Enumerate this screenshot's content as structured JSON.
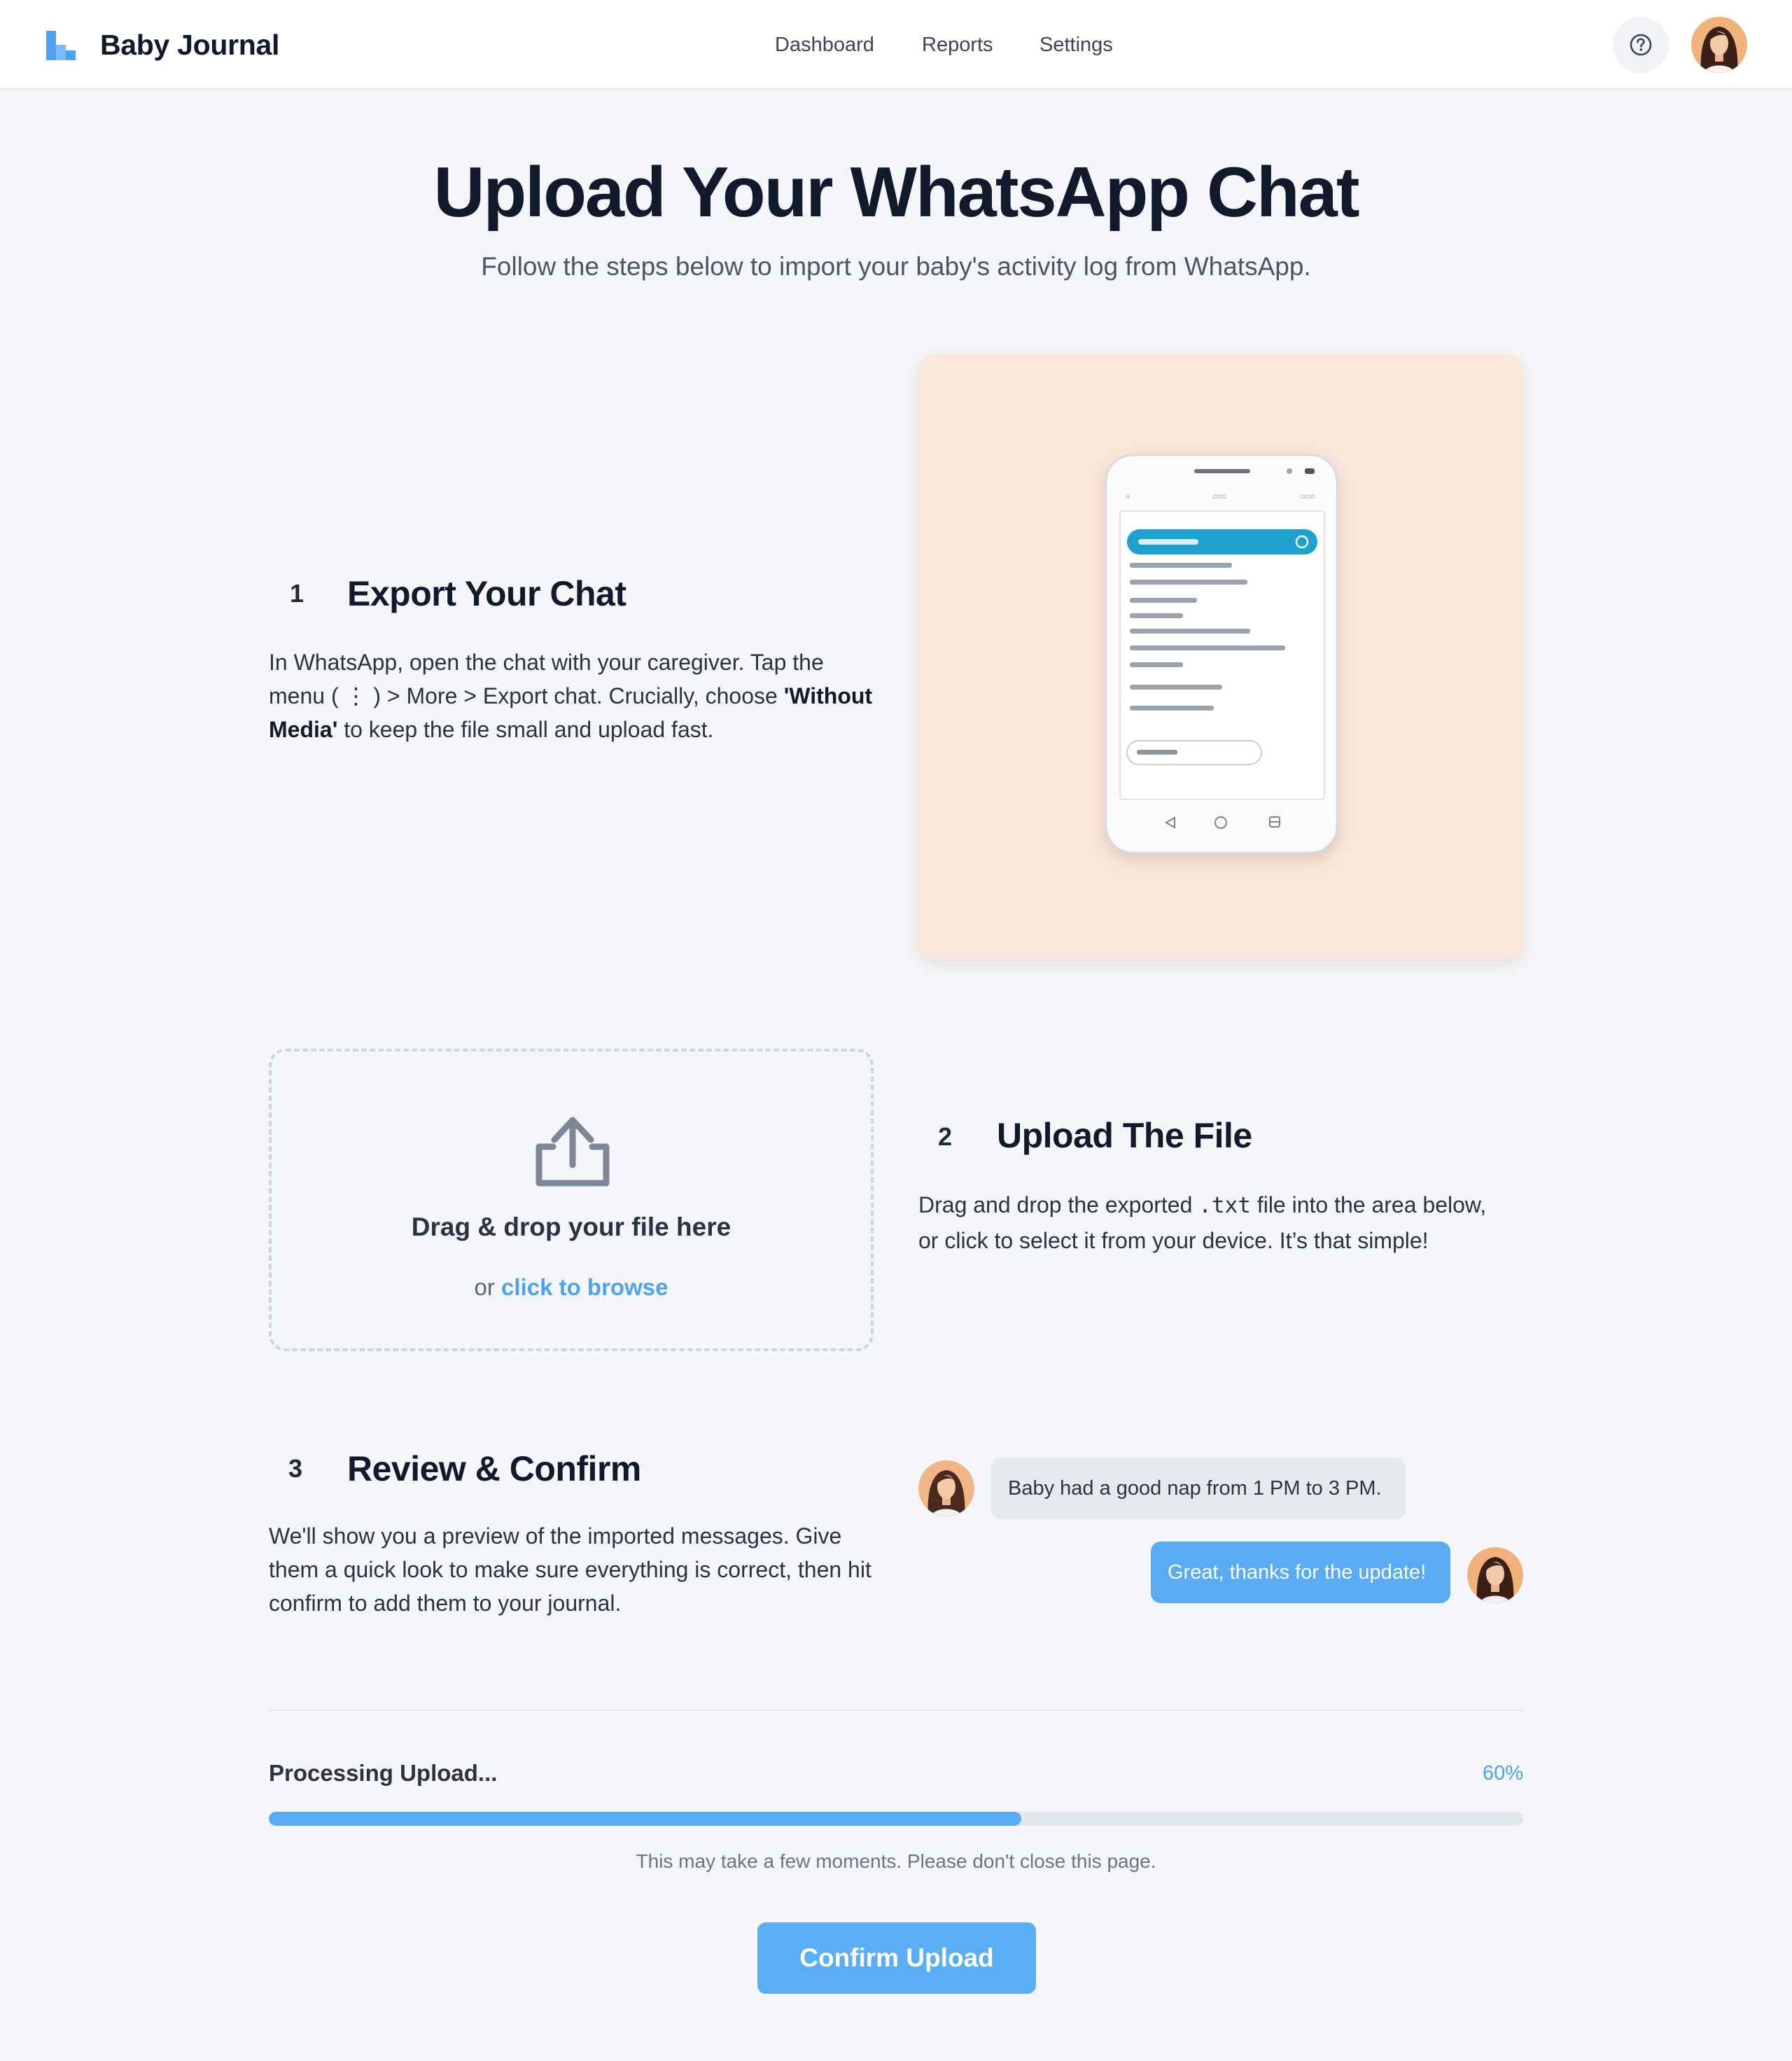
{
  "header": {
    "brand": "Baby Journal",
    "logo_icon": "bar-logo-icon",
    "nav": [
      {
        "label": "Dashboard"
      },
      {
        "label": "Reports"
      },
      {
        "label": "Settings"
      }
    ],
    "help_icon": "question-circle-icon",
    "avatar_icon": "user-avatar"
  },
  "hero": {
    "title": "Upload Your WhatsApp Chat",
    "subtitle": "Follow the steps below to import your baby's activity log from WhatsApp."
  },
  "steps": [
    {
      "number": "1",
      "title": "Export Your Chat",
      "body_before": "In WhatsApp, open the chat with your caregiver. Tap the menu ( ⋮ ) > More > Export chat. Crucially, choose ",
      "body_bold": "'Without Media'",
      "body_after": " to keep the file small and upload fast."
    },
    {
      "number": "2",
      "title": "Upload The File",
      "body_before": "Drag and drop the exported ",
      "body_code": ".txt",
      "body_after": " file into the area below, or click to select it from your device. It’s that simple!"
    },
    {
      "number": "3",
      "title": "Review & Confirm",
      "body": "We'll show you a preview of the imported messages. Give them a quick look to make sure everything is correct, then hit confirm to add them to your journal."
    }
  ],
  "dropzone": {
    "icon": "upload-tray-icon",
    "title": "Drag & drop your file here",
    "or": "or ",
    "link": "click to browse"
  },
  "chat_preview": {
    "incoming": "Baby had a good nap from 1 PM to 3 PM.",
    "outgoing": "Great, thanks for the update!"
  },
  "progress": {
    "label": "Processing Upload...",
    "percent_label": "60%",
    "value": 0.6,
    "note": "This may take a few moments. Please don't close this page."
  },
  "confirm_label": "Confirm Upload",
  "colors": {
    "accent": "#58acf4",
    "link": "#4da3f2",
    "illustration_bg": "#f9e7da",
    "page_bg": "#f5f6f9"
  }
}
